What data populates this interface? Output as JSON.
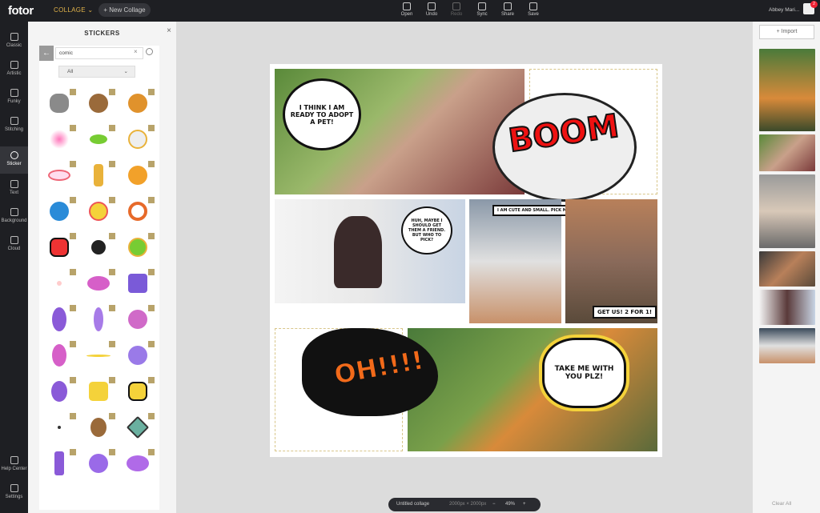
{
  "topbar": {
    "logo": "fotor",
    "mode": "COLLAGE ⌄",
    "new_collage": "+ New Collage",
    "tools": [
      {
        "label": "Open",
        "icon": "open-icon"
      },
      {
        "label": "Undo",
        "icon": "undo-icon"
      },
      {
        "label": "Redo",
        "icon": "redo-icon"
      },
      {
        "label": "Sync",
        "icon": "sync-icon"
      },
      {
        "label": "Share",
        "icon": "share-icon"
      },
      {
        "label": "Save",
        "icon": "save-icon"
      }
    ],
    "user": "Abbey Mari...",
    "notifications": "2"
  },
  "leftnav": [
    {
      "label": "Classic",
      "icon": "classic-icon"
    },
    {
      "label": "Artistic",
      "icon": "artistic-icon"
    },
    {
      "label": "Funky",
      "icon": "funky-icon"
    },
    {
      "label": "Stitching",
      "icon": "stitching-icon"
    },
    {
      "label": "Sticker",
      "icon": "sticker-icon"
    },
    {
      "label": "Text",
      "icon": "text-icon"
    },
    {
      "label": "Background",
      "icon": "background-icon"
    },
    {
      "label": "Cloud",
      "icon": "cloud-icon"
    },
    {
      "label": "Help Center",
      "icon": "help-icon"
    },
    {
      "label": "Settings",
      "icon": "settings-icon"
    }
  ],
  "stickers": {
    "title": "STICKERS",
    "close": "×",
    "back": "←",
    "search_value": "comic",
    "clear": "×",
    "filter": "All",
    "filter_caret": "⌄"
  },
  "collage": {
    "bubble1": "I THINK I AM READY TO ADOPT A PET!",
    "boom": "BOOM",
    "bubble2": "HUH, MAYBE I SHOULD GET THEM A FRIEND. BUT WHO TO PICK?",
    "label1": "I AM CUTE AND SMALL. PICK ME!",
    "label2": "GET US! 2 FOR 1!",
    "oh": "OH!!!!",
    "bubble3": "TAKE ME WITH YOU PLZ!"
  },
  "rightpanel": {
    "import": "+ Import",
    "clear_all": "Clear All"
  },
  "bottombar": {
    "name": "Untitled collage",
    "size": "2000px × 2000px",
    "minus": "−",
    "zoom": "49%",
    "plus": "+"
  }
}
